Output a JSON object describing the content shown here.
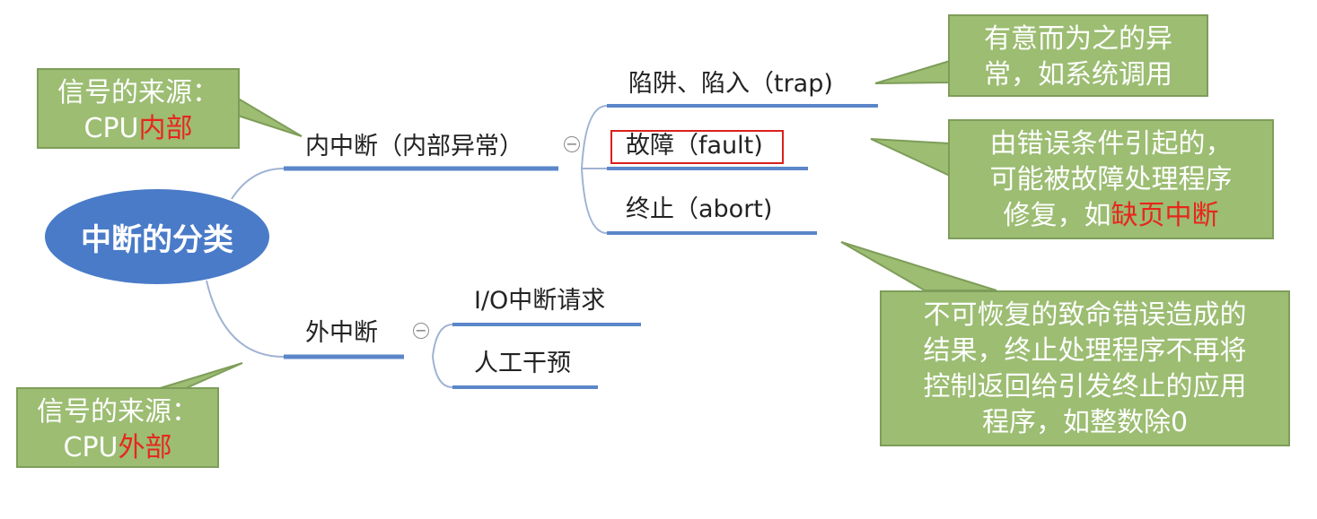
{
  "root": {
    "label": "中断的分类"
  },
  "branches": {
    "internal": {
      "label": "内中断（内部异常）",
      "children": {
        "trap": "陷阱、陷入（trap)",
        "fault": "故障（fault)",
        "abort": "终止（abort)"
      }
    },
    "external": {
      "label": "外中断",
      "children": {
        "io": "I/O中断请求",
        "manual": "人工干预"
      }
    }
  },
  "callouts": {
    "internal_source": {
      "line1": "信号的来源：",
      "line2_prefix": "CPU",
      "line2_highlight": "内部"
    },
    "external_source": {
      "line1": "信号的来源：",
      "line2_prefix": "CPU",
      "line2_highlight": "外部"
    },
    "trap_note": {
      "line1": "有意而为之的异",
      "line2": "常，如系统调用"
    },
    "fault_note": {
      "line1": "由错误条件引起的，",
      "line2": "可能被故障处理程序",
      "line3_prefix": "修复，如",
      "line3_highlight": "缺页中断"
    },
    "abort_note": {
      "line1": "不可恢复的致命错误造成的",
      "line2": "结果，终止处理程序不再将",
      "line3": "控制返回给引发终止的应用",
      "line4": "程序，如整数除0"
    }
  },
  "colors": {
    "root_fill": "#4a7bc8",
    "underline": "#5b86c9",
    "callout_fill": "#9cbd72",
    "callout_border": "#7e9d5a",
    "highlight_text": "#e8261c"
  },
  "icons": {
    "collapse_internal": "collapse-minus-icon",
    "collapse_external": "collapse-minus-icon"
  }
}
